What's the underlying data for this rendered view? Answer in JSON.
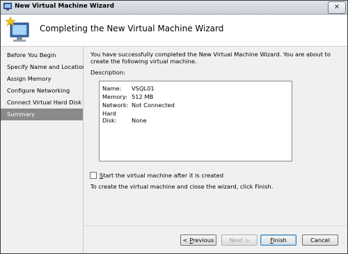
{
  "window": {
    "title": "New Virtual Machine Wizard",
    "close_glyph": "✕"
  },
  "header": {
    "title": "Completing the New Virtual Machine Wizard",
    "icon": "wizard-computer-star-icon"
  },
  "nav": {
    "items": [
      {
        "label": "Before You Begin"
      },
      {
        "label": "Specify Name and Location"
      },
      {
        "label": "Assign Memory"
      },
      {
        "label": "Configure Networking"
      },
      {
        "label": "Connect Virtual Hard Disk"
      },
      {
        "label": "Summary"
      }
    ],
    "selected_index": 5
  },
  "content": {
    "intro": "You have successfully completed the New Virtual Machine Wizard. You are about to create the following virtual machine.",
    "description_label": "Description:",
    "description": [
      {
        "key": "Name:",
        "value": "VSQL01"
      },
      {
        "key": "Memory:",
        "value": "512 MB"
      },
      {
        "key": "Network:",
        "value": "Not Connected"
      },
      {
        "key": "Hard Disk:",
        "value": "None"
      }
    ],
    "start_checkbox": {
      "checked": false,
      "label_prefix": "S",
      "label_rest": "tart the virtual machine after it is created"
    },
    "finish_note": "To create the virtual machine and close the wizard, click Finish."
  },
  "buttons": {
    "previous": {
      "prefix": "< ",
      "mnemonic": "P",
      "rest": "revious"
    },
    "next": {
      "label": "Next >"
    },
    "finish": {
      "mnemonic": "F",
      "rest": "inish"
    },
    "cancel": {
      "label": "Cancel"
    }
  },
  "colors": {
    "selected_nav_bg": "#8a8a8a",
    "panel_bg": "#f0f0f0",
    "title_bar": "#d4d8e0"
  }
}
